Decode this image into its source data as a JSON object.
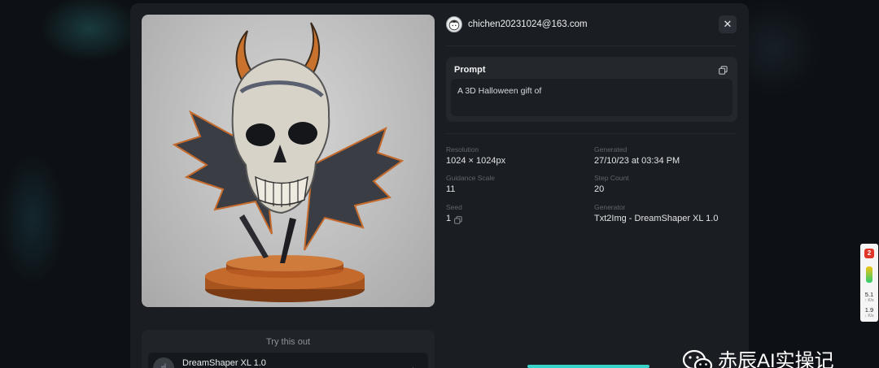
{
  "user": {
    "email": "chichen20231024@163.com"
  },
  "prompt": {
    "label": "Prompt",
    "text": "A 3D Halloween gift of"
  },
  "meta": {
    "resolution": {
      "label": "Resolution",
      "value": "1024 × 1024px"
    },
    "generated": {
      "label": "Generated",
      "value": "27/10/23 at 03:34 PM"
    },
    "guidance": {
      "label": "Guidance Scale",
      "value": "11"
    },
    "steps": {
      "label": "Step Count",
      "value": "20"
    },
    "seed": {
      "label": "Seed",
      "value": "1"
    },
    "generator": {
      "label": "Generator",
      "value": "Txt2Img - DreamShaper XL 1.0"
    }
  },
  "try": {
    "title": "Try this out",
    "model_name": "DreamShaper XL 1.0"
  },
  "side_widget": {
    "badge": "2",
    "upload_speed": "5.1",
    "upload_unit": "↑ K/s",
    "download_speed": "1.9",
    "download_unit": "↓ K/s"
  },
  "watermark": {
    "text": "赤辰AI实操记"
  },
  "icons": {
    "close": "close-icon",
    "copy": "copy-icon",
    "avatar": "user-avatar-icon",
    "arrow": "arrow-right-icon",
    "wechat": "wechat-icon"
  },
  "colors": {
    "accent": "#3ad1c8",
    "badge": "#e0362a"
  }
}
